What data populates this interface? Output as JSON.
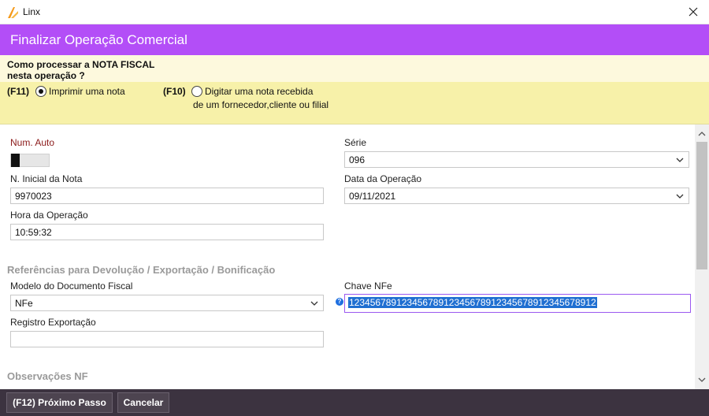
{
  "window": {
    "title": "Linx"
  },
  "header": {
    "title": "Finalizar Operação Comercial"
  },
  "question": {
    "line1": "Como processar a NOTA FISCAL",
    "line2": "nesta operação ?"
  },
  "options": [
    {
      "key": "(F11)",
      "label": "Imprimir uma nota",
      "selected": true
    },
    {
      "key": "(F10)",
      "label": "Digitar uma nota recebida",
      "label2": "de um fornecedor,cliente ou filial",
      "selected": false
    }
  ],
  "form": {
    "num_auto": {
      "label": "Num. Auto"
    },
    "serie": {
      "label": "Série",
      "value": "096"
    },
    "n_inicial": {
      "label": "N. Inicial da Nota",
      "value": "9970023"
    },
    "data_operacao": {
      "label": "Data da Operação",
      "value": "09/11/2021"
    },
    "hora_operacao": {
      "label": "Hora da Operação",
      "value": "10:59:32"
    },
    "section_ref": "Referências para Devolução / Exportação / Bonificação",
    "modelo": {
      "label": "Modelo do Documento Fiscal",
      "value": "NFe"
    },
    "chave": {
      "label": "Chave NFe",
      "value": "12345678912345678912345678912345678912345678912"
    },
    "registro": {
      "label": "Registro Exportação",
      "value": ""
    },
    "section_obs": "Observações NF"
  },
  "footer": {
    "next_label": "(F12) Próximo Passo",
    "cancel_label": "Cancelar"
  },
  "colors": {
    "header": "#b34ef7",
    "footer": "#3c3340",
    "question_bg": "#fdf9dd",
    "options_bg": "#f7f1a9",
    "accent_border": "#9b59f0",
    "selection": "#1f6fd1",
    "label_red": "#8b1a1a"
  }
}
